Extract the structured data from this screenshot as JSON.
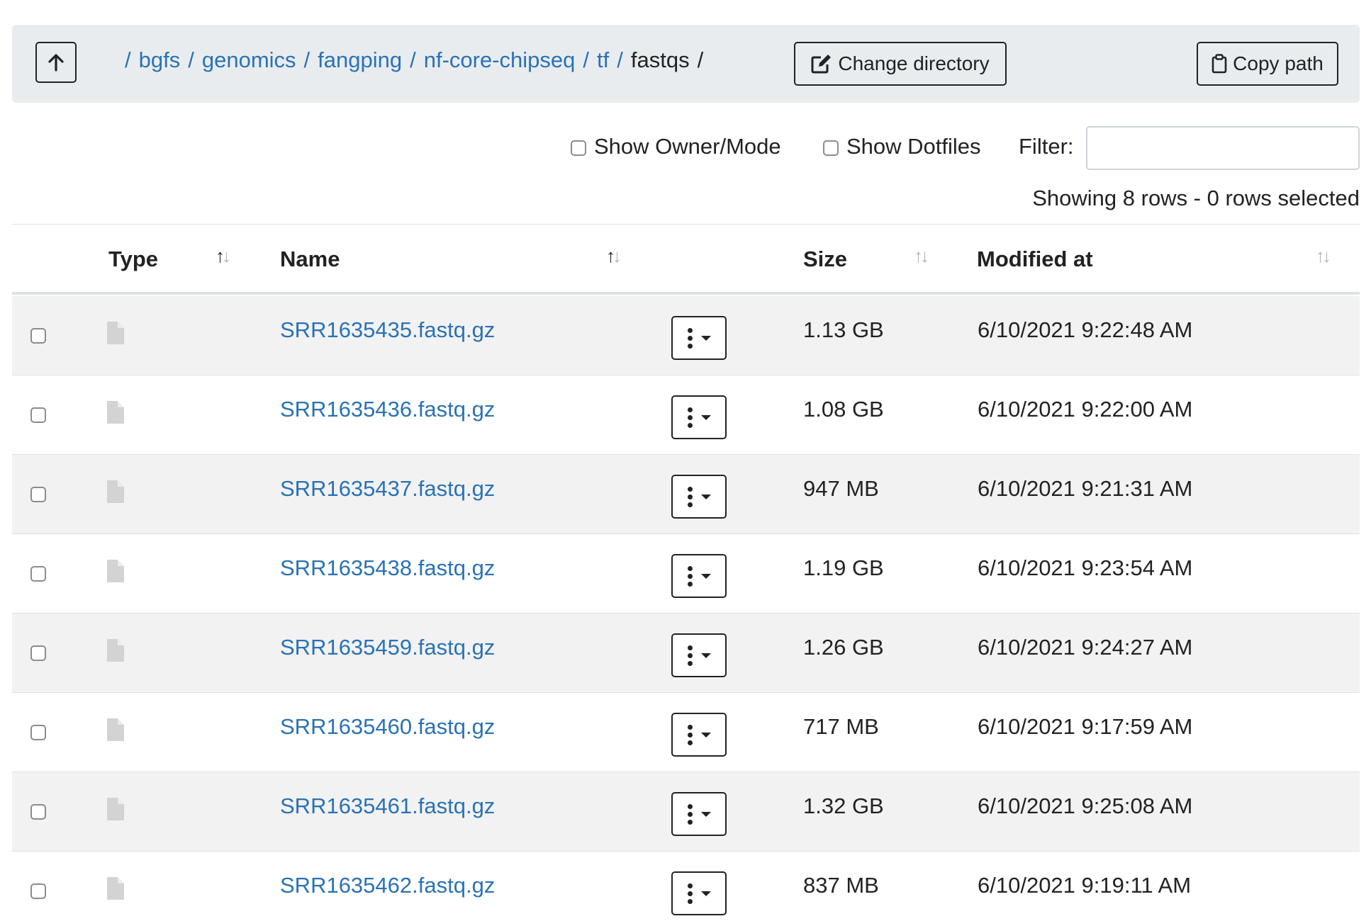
{
  "pathbar": {
    "crumbs": [
      {
        "label": "bgfs"
      },
      {
        "label": "genomics"
      },
      {
        "label": "fangping"
      },
      {
        "label": "nf-core-chipseq"
      },
      {
        "label": "tf"
      }
    ],
    "current": "fastqs",
    "change_directory_label": "Change directory",
    "copy_path_label": "Copy path"
  },
  "controls": {
    "show_owner_mode_label": "Show Owner/Mode",
    "show_owner_mode_checked": false,
    "show_dotfiles_label": "Show Dotfiles",
    "show_dotfiles_checked": false,
    "filter_label": "Filter:",
    "filter_value": "",
    "row_info": "Showing 8 rows - 0 rows selected"
  },
  "table": {
    "columns": {
      "type": "Type",
      "name": "Name",
      "size": "Size",
      "modified": "Modified at"
    },
    "rows": [
      {
        "name": "SRR1635435.fastq.gz",
        "size": "1.13 GB",
        "modified": "6/10/2021 9:22:48 AM"
      },
      {
        "name": "SRR1635436.fastq.gz",
        "size": "1.08 GB",
        "modified": "6/10/2021 9:22:00 AM"
      },
      {
        "name": "SRR1635437.fastq.gz",
        "size": "947 MB",
        "modified": "6/10/2021 9:21:31 AM"
      },
      {
        "name": "SRR1635438.fastq.gz",
        "size": "1.19 GB",
        "modified": "6/10/2021 9:23:54 AM"
      },
      {
        "name": "SRR1635459.fastq.gz",
        "size": "1.26 GB",
        "modified": "6/10/2021 9:24:27 AM"
      },
      {
        "name": "SRR1635460.fastq.gz",
        "size": "717 MB",
        "modified": "6/10/2021 9:17:59 AM"
      },
      {
        "name": "SRR1635461.fastq.gz",
        "size": "1.32 GB",
        "modified": "6/10/2021 9:25:08 AM"
      },
      {
        "name": "SRR1635462.fastq.gz",
        "size": "837 MB",
        "modified": "6/10/2021 9:19:11 AM"
      }
    ]
  },
  "icons": {
    "up": "arrow-up-icon",
    "change_directory": "edit-icon",
    "copy_path": "clipboard-icon",
    "file": "file-icon",
    "row_menu": "kebab-menu-icon",
    "sort": "sort-icon"
  },
  "colors": {
    "link": "#2a72b5",
    "pathbar_bg": "#e9ecef",
    "row_stripe": "#f2f2f2",
    "file_icon": "#d3d3d3"
  }
}
